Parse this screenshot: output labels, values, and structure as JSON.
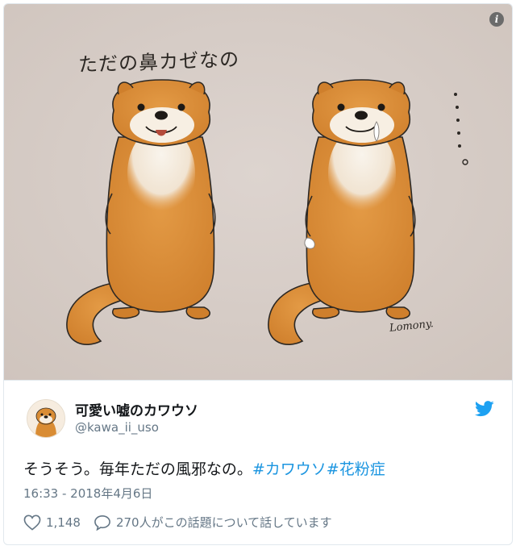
{
  "tweet": {
    "media": {
      "caption_art": "ただの鼻カゼなの",
      "signature": "Lomony.",
      "info_icon": "info-icon",
      "colors": {
        "background": "#d8cec8",
        "fur": "#d98c34",
        "fur_dark": "#b8691e",
        "cream": "#f6efe6"
      }
    },
    "user": {
      "name": "可愛い嘘のカワウソ",
      "handle": "@kawa_ii_uso",
      "avatar_icon": "otter-avatar-icon"
    },
    "brand_icon": "twitter-bird-icon",
    "text": "そうそう。毎年ただの風邪なの。",
    "hashtags": [
      "#カワウソ",
      "#花粉症"
    ],
    "timestamp": "16:33 - 2018年4月6日",
    "likes": "1,148",
    "reply_text": "270人がこの話題について話しています",
    "colors": {
      "link": "#1b95e0",
      "muted": "#657786",
      "twitter_blue": "#1da1f2"
    }
  }
}
